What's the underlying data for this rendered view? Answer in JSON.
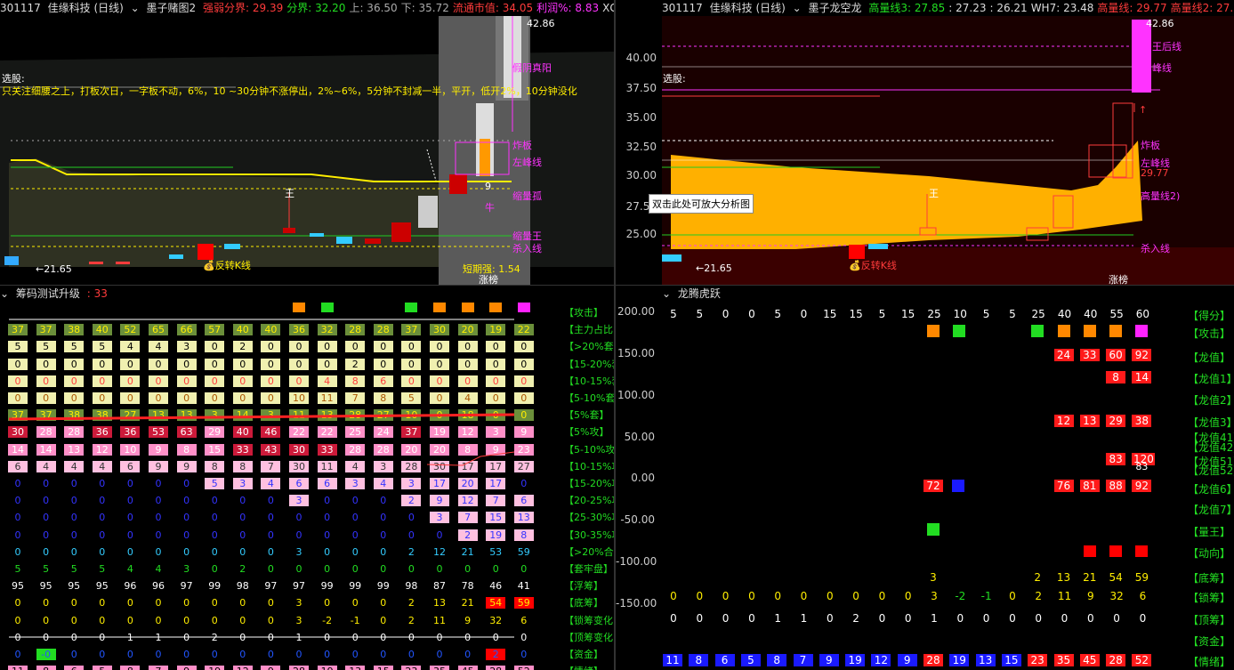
{
  "top_left": {
    "code": "301117",
    "name": "佳缘科技 (日线)",
    "indicator": "墨子赌图2",
    "stats": [
      {
        "label": "强弱分界:",
        "value": "29.39",
        "color": "#ff3b3b"
      },
      {
        "label": "分界:",
        "value": "32.20",
        "color": "#22dd22"
      },
      {
        "label": "上:",
        "value": "36.50",
        "color": "#aaaaaa"
      },
      {
        "label": "下:",
        "value": "35.72",
        "color": "#aaaaaa"
      },
      {
        "label": "流通市值:",
        "value": "34.05",
        "color": "#ff3b3b"
      },
      {
        "label": "利润%:",
        "value": "8.83",
        "color": "#ff33ff"
      },
      {
        "label": "XG9:",
        "value": "0.0",
        "color": "#dddddd"
      }
    ],
    "select_label": "选股:",
    "select_text": "只关注细腰之上，打板次日，一字板不动，6%，10 ~30分钟不涨停出，2%~6%，5分钟不封减一半，平开，低开2%，10分钟没化",
    "annotations": {
      "high": "42.86",
      "low": "←21.65",
      "yinyang": "假阴真阳",
      "zhaban": "炸板",
      "zuofeng": "左峰线",
      "shulianghu": "缩量孤",
      "suoliangwang": "缩量王",
      "shaRu": "杀入线",
      "fanzhuan": "反转K线",
      "duanqi": "短期强: 1.54",
      "zhangting": "涨榜",
      "wang": "王",
      "niu": "牛",
      "nine": "9"
    }
  },
  "top_right": {
    "code": "301117",
    "name": "佳缘科技 (日线)",
    "indicator": "墨子龙空龙",
    "stats": [
      {
        "label": "高量线3:",
        "value": "27.85",
        "color": "#22dd22"
      },
      {
        "label": ":",
        "value": "27.23",
        "color": "#dddddd"
      },
      {
        "label": ":",
        "value": "26.21",
        "color": "#dddddd"
      },
      {
        "label": "WH7:",
        "value": "23.48",
        "color": "#dddddd"
      },
      {
        "label": "高量线:",
        "value": "29.77",
        "color": "#ff3b3b"
      },
      {
        "label": "高量线2:",
        "value": "27.98",
        "color": "#ff3b3b"
      },
      {
        "label": "高量",
        "value": "",
        "color": "#ff33ff"
      }
    ],
    "select_label": "选股:",
    "axis": [
      "40.00",
      "37.50",
      "35.00",
      "32.50",
      "30.00",
      "27.50",
      "25.00"
    ],
    "tooltip": "双击此处可放大分析图",
    "annotations": {
      "high": "42.86",
      "low": "←21.65",
      "wanghou": "王后线",
      "fengxian": "峰线",
      "zhaban": "炸板",
      "zuofeng": "左峰线",
      "val2977": "29.77",
      "gaoliang2": "高量线2)",
      "shaRu": "杀入线",
      "fanzhuan": "反转K线",
      "zhangting": "涨榜",
      "wang": "王"
    }
  },
  "bottom_left": {
    "title": "筹码测试升级",
    "title_value": ": 33",
    "row_labels": [
      "【攻击】",
      "【主力占比",
      "【>20%套】",
      "【15-20%套",
      "【10-15%套",
      "【5-10%套",
      "【5%套】",
      "【5%攻】",
      "【5-10%攻",
      "【10-15%攻",
      "【15-20%攻",
      "【20-25%攻",
      "【25-30%攻",
      "【30-35%攻",
      "【>20%合计",
      "【套牢盘】",
      "【浮筹】",
      "【底筹】",
      "【锁筹变化",
      "【顶筹变化",
      "【资金】",
      "【情绪】"
    ],
    "rows": [
      [
        "",
        "",
        "",
        "",
        "",
        "",
        "",
        "",
        "",
        "",
        "",
        "",
        "",
        "",
        "",
        "",
        "",
        "",
        "",
        "",
        ""
      ],
      [
        "37",
        "37",
        "38",
        "40",
        "52",
        "65",
        "66",
        "57",
        "40",
        "40",
        "36",
        "32",
        "28",
        "28",
        "37",
        "30",
        "20",
        "19",
        "22"
      ],
      [
        "5",
        "5",
        "5",
        "5",
        "4",
        "4",
        "3",
        "0",
        "2",
        "0",
        "0",
        "0",
        "0",
        "0",
        "0",
        "0",
        "0",
        "0",
        "0"
      ],
      [
        "0",
        "0",
        "0",
        "0",
        "0",
        "0",
        "0",
        "0",
        "0",
        "0",
        "0",
        "0",
        "2",
        "0",
        "0",
        "0",
        "0",
        "0",
        "0"
      ],
      [
        "0",
        "0",
        "0",
        "0",
        "0",
        "0",
        "0",
        "0",
        "0",
        "0",
        "0",
        "4",
        "8",
        "6",
        "0",
        "0",
        "0",
        "0",
        "0"
      ],
      [
        "0",
        "0",
        "0",
        "0",
        "0",
        "0",
        "0",
        "0",
        "0",
        "0",
        "10",
        "11",
        "7",
        "8",
        "5",
        "0",
        "4",
        "0",
        "0"
      ],
      [
        "37",
        "37",
        "38",
        "38",
        "27",
        "13",
        "13",
        "3",
        "14",
        "3",
        "11",
        "13",
        "28",
        "27",
        "10",
        "0",
        "18",
        "0",
        "0"
      ],
      [
        "30",
        "28",
        "28",
        "36",
        "36",
        "53",
        "63",
        "29",
        "40",
        "46",
        "22",
        "22",
        "25",
        "24",
        "37",
        "19",
        "12",
        "3",
        "9"
      ],
      [
        "14",
        "14",
        "13",
        "12",
        "10",
        "9",
        "8",
        "15",
        "33",
        "43",
        "30",
        "33",
        "28",
        "28",
        "20",
        "20",
        "8",
        "9",
        "23"
      ],
      [
        "6",
        "4",
        "4",
        "4",
        "6",
        "9",
        "9",
        "8",
        "8",
        "7",
        "30",
        "11",
        "4",
        "3",
        "28",
        "30",
        "17",
        "17",
        "27"
      ],
      [
        "0",
        "0",
        "0",
        "0",
        "0",
        "0",
        "0",
        "5",
        "3",
        "4",
        "6",
        "6",
        "3",
        "4",
        "3",
        "17",
        "20",
        "17",
        "0"
      ],
      [
        "0",
        "0",
        "0",
        "0",
        "0",
        "0",
        "0",
        "0",
        "0",
        "0",
        "3",
        "0",
        "0",
        "0",
        "2",
        "9",
        "12",
        "7",
        "6"
      ],
      [
        "0",
        "0",
        "0",
        "0",
        "0",
        "0",
        "0",
        "0",
        "0",
        "0",
        "0",
        "0",
        "0",
        "0",
        "0",
        "3",
        "7",
        "15",
        "13"
      ],
      [
        "0",
        "0",
        "0",
        "0",
        "0",
        "0",
        "0",
        "0",
        "0",
        "0",
        "0",
        "0",
        "0",
        "0",
        "0",
        "0",
        "2",
        "19",
        "8"
      ],
      [
        "0",
        "0",
        "0",
        "0",
        "0",
        "0",
        "0",
        "0",
        "0",
        "0",
        "3",
        "0",
        "0",
        "0",
        "2",
        "12",
        "21",
        "53",
        "59"
      ],
      [
        "5",
        "5",
        "5",
        "5",
        "4",
        "4",
        "3",
        "0",
        "2",
        "0",
        "0",
        "0",
        "0",
        "0",
        "0",
        "0",
        "0",
        "0",
        "0"
      ],
      [
        "95",
        "95",
        "95",
        "95",
        "96",
        "96",
        "97",
        "99",
        "98",
        "97",
        "97",
        "99",
        "99",
        "99",
        "98",
        "87",
        "78",
        "46",
        "41"
      ],
      [
        "0",
        "0",
        "0",
        "0",
        "0",
        "0",
        "0",
        "0",
        "0",
        "0",
        "3",
        "0",
        "0",
        "0",
        "2",
        "13",
        "21",
        "54",
        "59"
      ],
      [
        "0",
        "0",
        "0",
        "0",
        "0",
        "0",
        "0",
        "0",
        "0",
        "0",
        "3",
        "-2",
        "-1",
        "0",
        "2",
        "11",
        "9",
        "32",
        "6"
      ],
      [
        "0",
        "0",
        "0",
        "0",
        "1",
        "1",
        "0",
        "2",
        "0",
        "0",
        "1",
        "0",
        "0",
        "0",
        "0",
        "0",
        "0",
        "0",
        "0"
      ],
      [
        "0",
        "-0",
        "0",
        "0",
        "0",
        "0",
        "0",
        "0",
        "0",
        "0",
        "0",
        "0",
        "0",
        "0",
        "0",
        "0",
        "0",
        "2",
        "0"
      ],
      [
        "11",
        "8",
        "6",
        "5",
        "8",
        "7",
        "9",
        "19",
        "12",
        "9",
        "28",
        "19",
        "13",
        "15",
        "23",
        "35",
        "45",
        "28",
        "52"
      ]
    ]
  },
  "bottom_right": {
    "title": "龙腾虎跃",
    "axis": [
      "200.00",
      "150.00",
      "100.00",
      "50.00",
      "0.00",
      "-50.00",
      "-100.00",
      "-150.00"
    ],
    "score_row": [
      "5",
      "5",
      "0",
      "0",
      "5",
      "0",
      "15",
      "15",
      "5",
      "15",
      "25",
      "10",
      "5",
      "5",
      "25",
      "40",
      "40",
      "55",
      "60"
    ],
    "row_labels": [
      "【得分】",
      "【攻击】",
      "【龙值】",
      "【龙值1】",
      "【龙值2】",
      "【龙值3】",
      "【龙值41】",
      "【龙值42】",
      "【龙值51】",
      "【龙值52】",
      "【龙值6】",
      "【龙值7】",
      "【量王】",
      "【动向】",
      "【底筹】",
      "【锁筹】",
      "【顶筹】",
      "【资金】",
      "【情绪】"
    ],
    "longzhi": [
      "24",
      "33",
      "60",
      "92"
    ],
    "longzhi1": [
      "8",
      "14"
    ],
    "longzhi3": [
      "12",
      "13",
      "29",
      "38"
    ],
    "longzhi5": [
      "83",
      "120",
      "83"
    ],
    "longzhi6": [
      "72",
      "76",
      "81",
      "88",
      "92"
    ],
    "dichou": [
      "3",
      "2",
      "13",
      "21",
      "54",
      "59"
    ],
    "suochou": [
      "0",
      "0",
      "0",
      "0",
      "0",
      "0",
      "0",
      "0",
      "0",
      "0",
      "3",
      "-2",
      "-1",
      "0",
      "2",
      "11",
      "9",
      "32",
      "6"
    ],
    "dingchou": [
      "0",
      "0",
      "0",
      "0",
      "1",
      "1",
      "0",
      "2",
      "0",
      "0",
      "1",
      "0",
      "0",
      "0",
      "0",
      "0",
      "0",
      "0",
      "0"
    ],
    "qingxu": [
      "11",
      "8",
      "6",
      "5",
      "8",
      "7",
      "9",
      "19",
      "12",
      "9",
      "28",
      "19",
      "13",
      "15",
      "23",
      "35",
      "45",
      "28",
      "52"
    ]
  }
}
